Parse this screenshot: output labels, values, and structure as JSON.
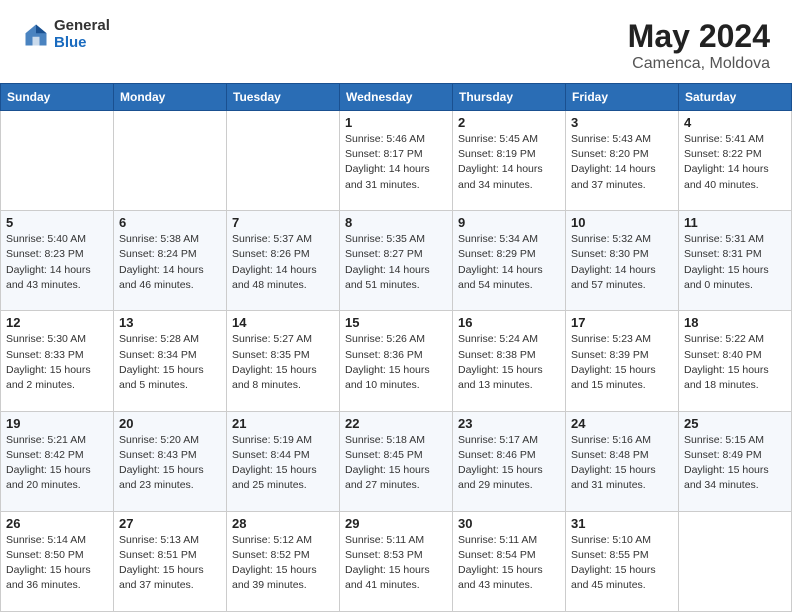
{
  "header": {
    "logo_general": "General",
    "logo_blue": "Blue",
    "title": "May 2024",
    "location": "Camenca, Moldova"
  },
  "days_of_week": [
    "Sunday",
    "Monday",
    "Tuesday",
    "Wednesday",
    "Thursday",
    "Friday",
    "Saturday"
  ],
  "weeks": [
    [
      {
        "day": "",
        "info": ""
      },
      {
        "day": "",
        "info": ""
      },
      {
        "day": "",
        "info": ""
      },
      {
        "day": "1",
        "info": "Sunrise: 5:46 AM\nSunset: 8:17 PM\nDaylight: 14 hours\nand 31 minutes."
      },
      {
        "day": "2",
        "info": "Sunrise: 5:45 AM\nSunset: 8:19 PM\nDaylight: 14 hours\nand 34 minutes."
      },
      {
        "day": "3",
        "info": "Sunrise: 5:43 AM\nSunset: 8:20 PM\nDaylight: 14 hours\nand 37 minutes."
      },
      {
        "day": "4",
        "info": "Sunrise: 5:41 AM\nSunset: 8:22 PM\nDaylight: 14 hours\nand 40 minutes."
      }
    ],
    [
      {
        "day": "5",
        "info": "Sunrise: 5:40 AM\nSunset: 8:23 PM\nDaylight: 14 hours\nand 43 minutes."
      },
      {
        "day": "6",
        "info": "Sunrise: 5:38 AM\nSunset: 8:24 PM\nDaylight: 14 hours\nand 46 minutes."
      },
      {
        "day": "7",
        "info": "Sunrise: 5:37 AM\nSunset: 8:26 PM\nDaylight: 14 hours\nand 48 minutes."
      },
      {
        "day": "8",
        "info": "Sunrise: 5:35 AM\nSunset: 8:27 PM\nDaylight: 14 hours\nand 51 minutes."
      },
      {
        "day": "9",
        "info": "Sunrise: 5:34 AM\nSunset: 8:29 PM\nDaylight: 14 hours\nand 54 minutes."
      },
      {
        "day": "10",
        "info": "Sunrise: 5:32 AM\nSunset: 8:30 PM\nDaylight: 14 hours\nand 57 minutes."
      },
      {
        "day": "11",
        "info": "Sunrise: 5:31 AM\nSunset: 8:31 PM\nDaylight: 15 hours\nand 0 minutes."
      }
    ],
    [
      {
        "day": "12",
        "info": "Sunrise: 5:30 AM\nSunset: 8:33 PM\nDaylight: 15 hours\nand 2 minutes."
      },
      {
        "day": "13",
        "info": "Sunrise: 5:28 AM\nSunset: 8:34 PM\nDaylight: 15 hours\nand 5 minutes."
      },
      {
        "day": "14",
        "info": "Sunrise: 5:27 AM\nSunset: 8:35 PM\nDaylight: 15 hours\nand 8 minutes."
      },
      {
        "day": "15",
        "info": "Sunrise: 5:26 AM\nSunset: 8:36 PM\nDaylight: 15 hours\nand 10 minutes."
      },
      {
        "day": "16",
        "info": "Sunrise: 5:24 AM\nSunset: 8:38 PM\nDaylight: 15 hours\nand 13 minutes."
      },
      {
        "day": "17",
        "info": "Sunrise: 5:23 AM\nSunset: 8:39 PM\nDaylight: 15 hours\nand 15 minutes."
      },
      {
        "day": "18",
        "info": "Sunrise: 5:22 AM\nSunset: 8:40 PM\nDaylight: 15 hours\nand 18 minutes."
      }
    ],
    [
      {
        "day": "19",
        "info": "Sunrise: 5:21 AM\nSunset: 8:42 PM\nDaylight: 15 hours\nand 20 minutes."
      },
      {
        "day": "20",
        "info": "Sunrise: 5:20 AM\nSunset: 8:43 PM\nDaylight: 15 hours\nand 23 minutes."
      },
      {
        "day": "21",
        "info": "Sunrise: 5:19 AM\nSunset: 8:44 PM\nDaylight: 15 hours\nand 25 minutes."
      },
      {
        "day": "22",
        "info": "Sunrise: 5:18 AM\nSunset: 8:45 PM\nDaylight: 15 hours\nand 27 minutes."
      },
      {
        "day": "23",
        "info": "Sunrise: 5:17 AM\nSunset: 8:46 PM\nDaylight: 15 hours\nand 29 minutes."
      },
      {
        "day": "24",
        "info": "Sunrise: 5:16 AM\nSunset: 8:48 PM\nDaylight: 15 hours\nand 31 minutes."
      },
      {
        "day": "25",
        "info": "Sunrise: 5:15 AM\nSunset: 8:49 PM\nDaylight: 15 hours\nand 34 minutes."
      }
    ],
    [
      {
        "day": "26",
        "info": "Sunrise: 5:14 AM\nSunset: 8:50 PM\nDaylight: 15 hours\nand 36 minutes."
      },
      {
        "day": "27",
        "info": "Sunrise: 5:13 AM\nSunset: 8:51 PM\nDaylight: 15 hours\nand 37 minutes."
      },
      {
        "day": "28",
        "info": "Sunrise: 5:12 AM\nSunset: 8:52 PM\nDaylight: 15 hours\nand 39 minutes."
      },
      {
        "day": "29",
        "info": "Sunrise: 5:11 AM\nSunset: 8:53 PM\nDaylight: 15 hours\nand 41 minutes."
      },
      {
        "day": "30",
        "info": "Sunrise: 5:11 AM\nSunset: 8:54 PM\nDaylight: 15 hours\nand 43 minutes."
      },
      {
        "day": "31",
        "info": "Sunrise: 5:10 AM\nSunset: 8:55 PM\nDaylight: 15 hours\nand 45 minutes."
      },
      {
        "day": "",
        "info": ""
      }
    ]
  ]
}
